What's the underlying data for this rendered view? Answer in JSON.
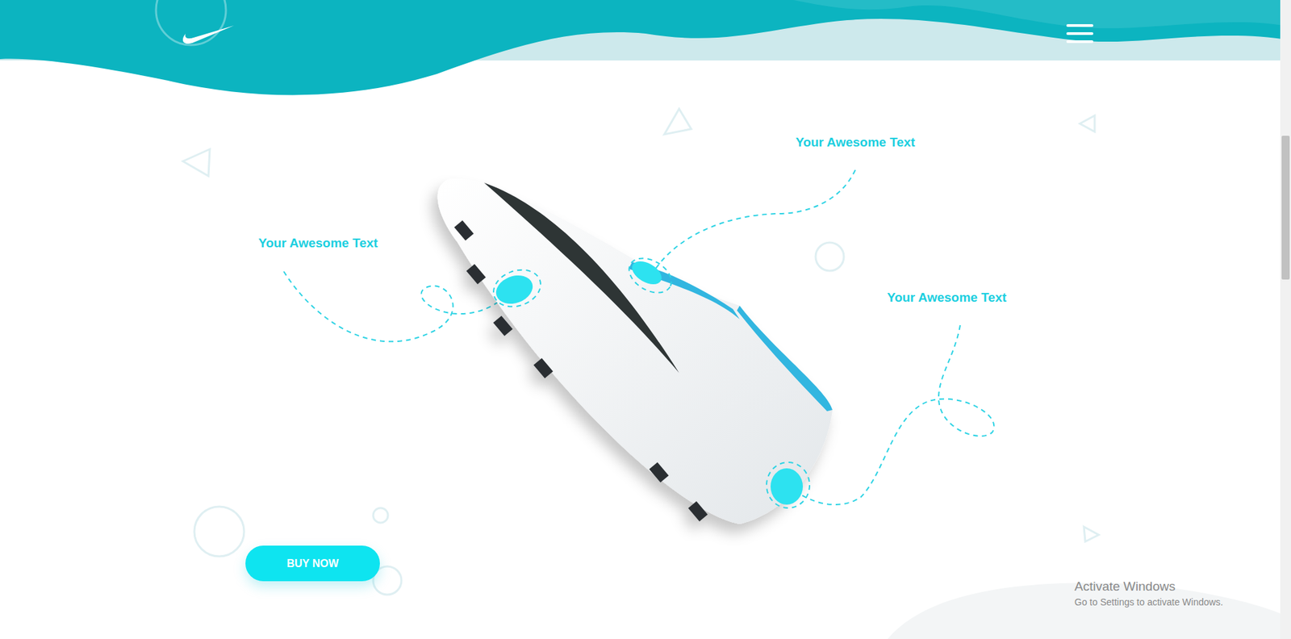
{
  "callouts": [
    {
      "label": "Your Awesome Text"
    },
    {
      "label": "Your Awesome Text"
    },
    {
      "label": "Your Awesome Text"
    }
  ],
  "cta": {
    "label": "BUY NOW"
  },
  "watermark": {
    "title": "Activate Windows",
    "subtitle": "Go to Settings to activate Windows."
  }
}
